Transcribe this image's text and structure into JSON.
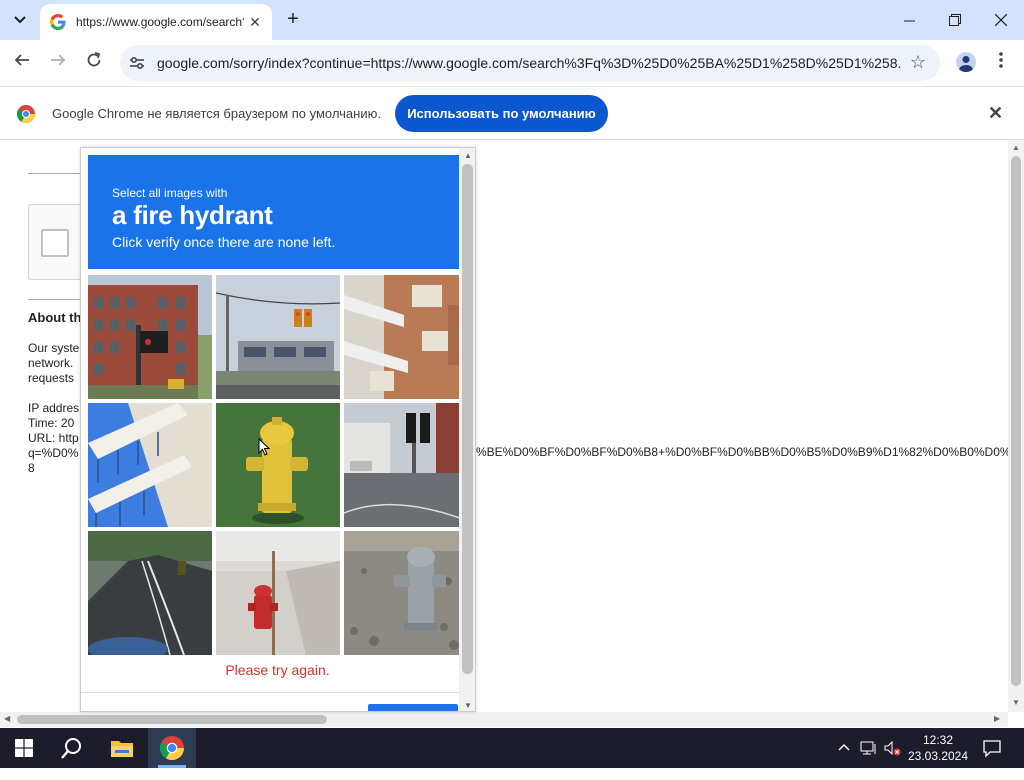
{
  "browser": {
    "tab_title": "https://www.google.com/search?q",
    "address": "google.com/sorry/index?continue=https://www.google.com/search%3Fq%3D%25D0%25BA%25D1%258D%25D1%258...",
    "infobar": {
      "message": "Google Chrome не является браузером по умолчанию.",
      "button_label": "Использовать по умолчанию"
    }
  },
  "page": {
    "about_heading": "About th",
    "para_lines": [
      "Our syste",
      "network.",
      "requests"
    ],
    "info_lines": [
      "IP addres",
      "Time: 20",
      "URL: http",
      "q=%D0%",
      "8"
    ],
    "url_continuation": "%BE%D0%BF%D0%BF%D0%B8+%D0%BF%D0%BB%D0%B5%D0%B9%D1%82%D0%B0%D0%B"
  },
  "captcha": {
    "instruction_top": "Select all images with",
    "target": "a fire hydrant",
    "instruction_bottom": "Click verify once there are none left.",
    "error": "Please try again.",
    "tiles": [
      {
        "scene": "brick-building-traffic-light"
      },
      {
        "scene": "traffic-light-street"
      },
      {
        "scene": "building-balconies"
      },
      {
        "scene": "balconies-blue-sky"
      },
      {
        "scene": "yellow-fire-hydrant"
      },
      {
        "scene": "traffic-light-corner"
      },
      {
        "scene": "wet-road"
      },
      {
        "scene": "red-fire-hydrant"
      },
      {
        "scene": "gray-fire-hydrant"
      }
    ]
  },
  "taskbar": {
    "time": "12:32",
    "date": "23.03.2024"
  },
  "colors": {
    "tabbar": "#d3e3fd",
    "primary_button": "#0b57d0",
    "captcha_blue": "#1a73e8",
    "error_red": "#d93025",
    "taskbar": "#1c1c2a"
  }
}
